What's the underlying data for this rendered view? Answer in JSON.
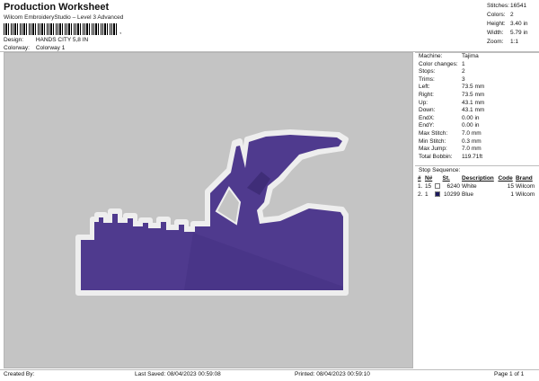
{
  "header": {
    "title": "Production Worksheet",
    "subtitle": "Wilcom EmbroideryStudio – Level 3 Advanced",
    "barcode_suffix": ",",
    "design_label": "Design:",
    "design_value": "HANDS CITY 5,8 IN",
    "colorway_label": "Colorway:",
    "colorway_value": "Colorway 1"
  },
  "stats": [
    {
      "label": "Stitches:",
      "value": "16541"
    },
    {
      "label": "Colors:",
      "value": "2"
    },
    {
      "label": "Height:",
      "value": "3.40 in"
    },
    {
      "label": "Width:",
      "value": "5.79 in"
    },
    {
      "label": "Zoom:",
      "value": "1:1"
    }
  ],
  "machine": [
    {
      "label": "Machine:",
      "value": "Tajima"
    },
    {
      "label": "Color changes:",
      "value": "1"
    },
    {
      "label": "Stops:",
      "value": "2"
    },
    {
      "label": "Trims:",
      "value": "3"
    },
    {
      "label": "Left:",
      "value": "73.5 mm"
    },
    {
      "label": "Right:",
      "value": "73.5 mm"
    },
    {
      "label": "Up:",
      "value": "43.1 mm"
    },
    {
      "label": "Down:",
      "value": "43.1 mm"
    },
    {
      "label": "EndX:",
      "value": "0.00 in"
    },
    {
      "label": "EndY:",
      "value": "0.00 in"
    },
    {
      "label": "Max Stitch:",
      "value": "7.0 mm"
    },
    {
      "label": "Min Stitch:",
      "value": "0.3 mm"
    },
    {
      "label": "Max Jump:",
      "value": "7.0 mm"
    },
    {
      "label": "Total Bobbin:",
      "value": "119.71ft"
    }
  ],
  "sequence": {
    "title": "Stop Sequence:",
    "headers": [
      "#",
      "N#",
      "St.",
      "Description",
      "Code",
      "Brand"
    ],
    "rows": [
      {
        "num": "1.",
        "n": "15",
        "color": "#ffffff",
        "st": "6240",
        "desc": "White",
        "code": "15",
        "brand": "Wilcom"
      },
      {
        "num": "2.",
        "n": "1",
        "color": "#1c1a5e",
        "st": "10299",
        "desc": "Blue",
        "code": "1",
        "brand": "Wilcom"
      }
    ]
  },
  "colors": {
    "canvas": "#c4c4c4",
    "design_fill": "#4f3a8e",
    "outline": "#eeeeee"
  },
  "footer": {
    "created": "Created By:",
    "last_saved": "Last Saved: 08/04/2023 00:59:08",
    "printed": "Printed: 08/04/2023 00:59:10",
    "page": "Page 1 of 1"
  }
}
